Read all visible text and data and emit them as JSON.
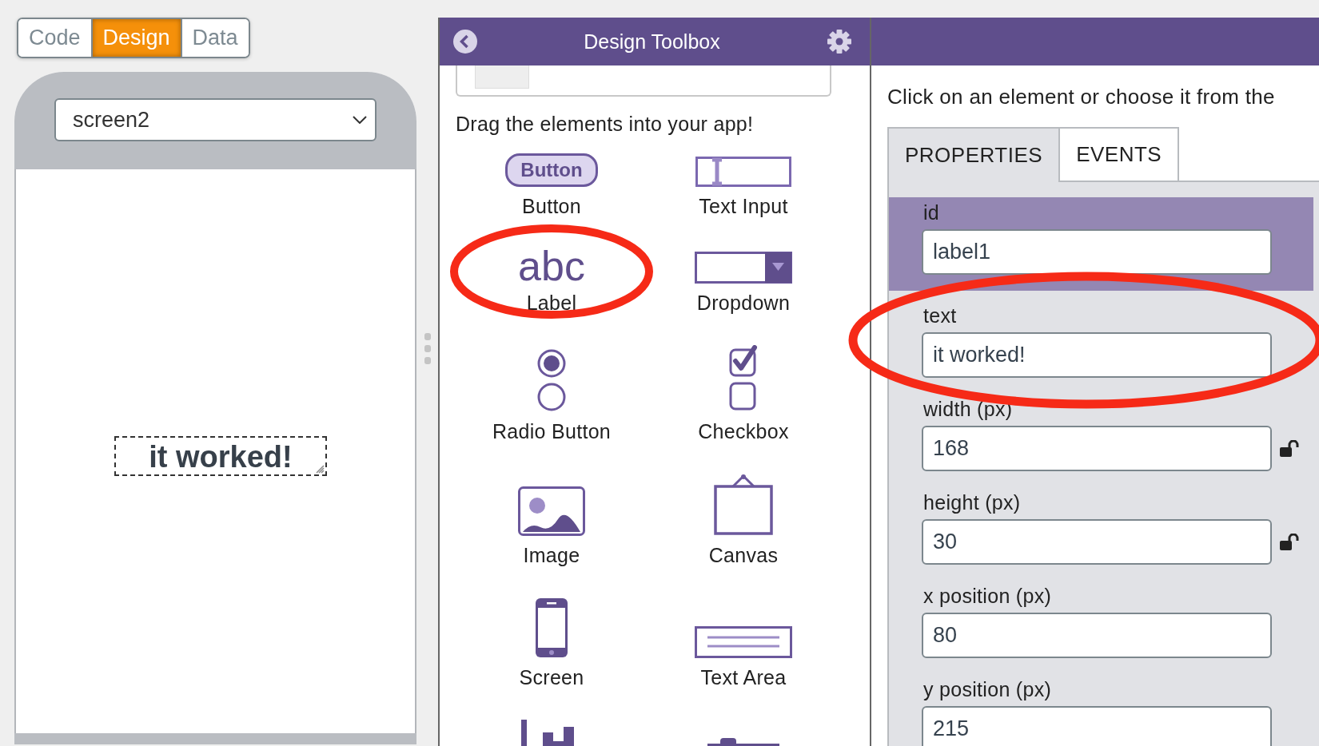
{
  "mode_tabs": [
    {
      "label": "Code",
      "selected": false
    },
    {
      "label": "Design",
      "selected": true
    },
    {
      "label": "Data",
      "selected": false
    }
  ],
  "screen_select": {
    "value": "screen2"
  },
  "canvas_label": {
    "text": "it worked!",
    "selected": true
  },
  "toolbox": {
    "title": "Design Toolbox",
    "instructions": "Drag the elements into your app!",
    "elements": [
      {
        "kind": "button",
        "label": "Button",
        "icon_text": "Button",
        "circled": false
      },
      {
        "kind": "text_input",
        "label": "Text Input",
        "circled": false
      },
      {
        "kind": "label",
        "label": "Label",
        "icon_text": "abc",
        "circled": true
      },
      {
        "kind": "dropdown",
        "label": "Dropdown",
        "circled": false
      },
      {
        "kind": "radio",
        "label": "Radio Button",
        "circled": false
      },
      {
        "kind": "checkbox",
        "label": "Checkbox",
        "circled": false
      },
      {
        "kind": "image",
        "label": "Image",
        "circled": false
      },
      {
        "kind": "canvas",
        "label": "Canvas",
        "circled": false
      },
      {
        "kind": "screen",
        "label": "Screen",
        "circled": false
      },
      {
        "kind": "text_area",
        "label": "Text Area",
        "circled": false
      },
      {
        "kind": "chart",
        "circled": false
      },
      {
        "kind": "slider",
        "circled": false
      }
    ]
  },
  "properties": {
    "hint": "Click on an element or choose it from the",
    "tabs": [
      {
        "label": "PROPERTIES",
        "selected": true
      },
      {
        "label": "EVENTS",
        "selected": false
      }
    ],
    "fields": [
      {
        "label": "id",
        "value": "label1",
        "highlighted": true,
        "circled": false
      },
      {
        "label": "text",
        "value": "it worked!",
        "highlighted": false,
        "circled": true
      },
      {
        "label": "width (px)",
        "value": "168",
        "highlighted": false,
        "circled": false,
        "locked": false
      },
      {
        "label": "height (px)",
        "value": "30",
        "highlighted": false,
        "circled": false,
        "locked": false
      },
      {
        "label": "x position (px)",
        "value": "80",
        "highlighted": false,
        "circled": false
      },
      {
        "label": "y position (px)",
        "value": "215",
        "highlighted": false,
        "circled": false
      }
    ]
  }
}
